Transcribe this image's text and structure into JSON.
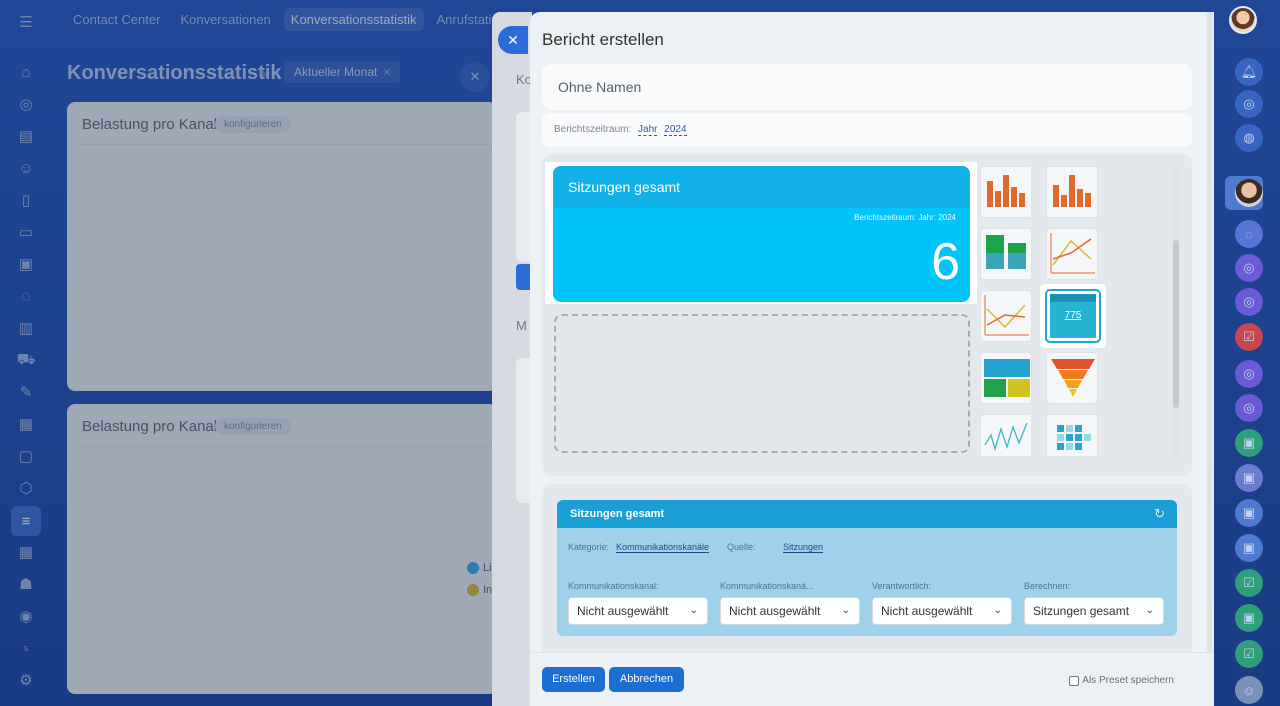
{
  "background": {
    "tabs": [
      "Contact Center",
      "Konversationen",
      "Konversationsstatistik",
      "Anrufstatistik"
    ],
    "active_tab_index": 2,
    "page_title": "Konversationsstatistik",
    "filter_chip": "Aktueller Monat",
    "cards": [
      {
        "title": "Belastung pro Kanal",
        "button": "konfigurieren"
      },
      {
        "title": "Belastung pro Kanal",
        "button": "konfigurieren"
      }
    ],
    "legend": [
      "Li",
      "In"
    ],
    "behind_slider_text": [
      "Ko",
      "M"
    ]
  },
  "dialog": {
    "title": "Bericht erstellen",
    "name_value": "Ohne Namen",
    "period_label": "Berichtszeitraum:",
    "period_unit": "Jahr",
    "period_year": "2024",
    "widget": {
      "title": "Sitzungen gesamt",
      "period_text": "Berichtszeitraum: Jahr: 2024",
      "value": "6",
      "color": "#00c3f9"
    },
    "thumbnail_sample_value": "775",
    "settings": {
      "title": "Sitzungen gesamt",
      "category_label": "Kategorie:",
      "category_value": "Kommunikationskanäle",
      "source_label": "Quelle:",
      "source_value": "Sitzungen",
      "fields": [
        {
          "label": "Kommunikationskanal:",
          "value": "Nicht ausgewählt"
        },
        {
          "label": "Kommunikationskanä...",
          "value": "Nicht ausgewählt"
        },
        {
          "label": "Verantwortlich:",
          "value": "Nicht ausgewählt"
        },
        {
          "label": "Berechnen:",
          "value": "Sitzungen gesamt"
        }
      ]
    },
    "buttons": {
      "create": "Erstellen",
      "cancel": "Abbrechen"
    },
    "preset_label": "Als Preset speichern"
  }
}
